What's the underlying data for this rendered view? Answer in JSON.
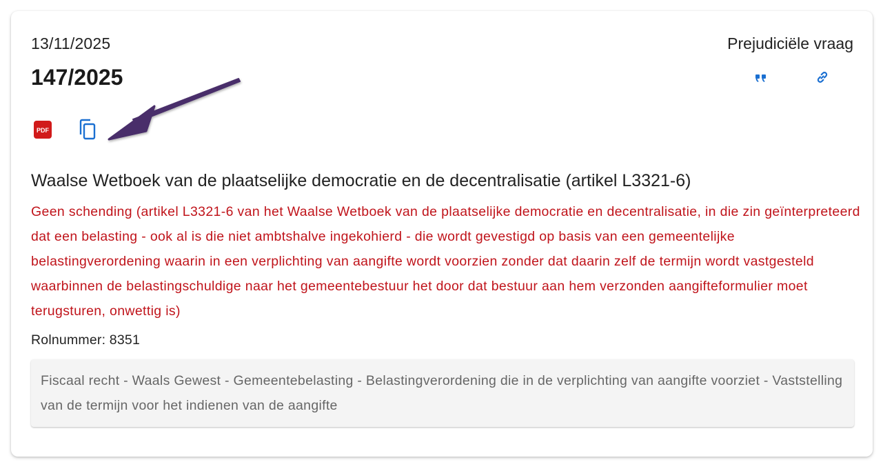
{
  "card": {
    "date": "13/11/2025",
    "type": "Prejudiciële vraag",
    "number": "147/2025",
    "actions": {
      "quote_icon": "quote-icon",
      "link_icon": "link-icon",
      "pdf_icon": "pdf-icon",
      "pdf_label": "PDF",
      "copy_icon": "copy-icon"
    },
    "title": "Waalse Wetboek van de plaatselijke democratie en de decentralisatie (artikel L3321-6)",
    "summary": "Geen schending (artikel L3321-6 van het Waalse Wetboek van de plaatselijke democratie en decentralisatie, in die zin geïnterpreteerd dat een belasting - ook al is die niet ambtshalve ingekohierd - die wordt gevestigd op basis van een gemeentelijke belastingverordening waarin in een verplichting van aangifte wordt voorzien zonder dat daarin zelf de termijn wordt vastgesteld waarbinnen de belastingschuldige naar het gemeentebestuur het door dat bestuur aan hem verzonden aangifteformulier moet terugsturen, onwettig is)",
    "rolnummer": "Rolnummer: 8351",
    "keywords": "Fiscaal recht - Waals Gewest - Gemeentebelasting - Belastingverordening die in de verplichting van aangifte voorziet - Vaststelling van de termijn voor het indienen van de aangifte"
  },
  "colors": {
    "accent_blue": "#1a6fd1",
    "summary_red": "#c0141b",
    "pdf_red": "#d11a1a",
    "arrow_purple": "#4a2f6b"
  }
}
